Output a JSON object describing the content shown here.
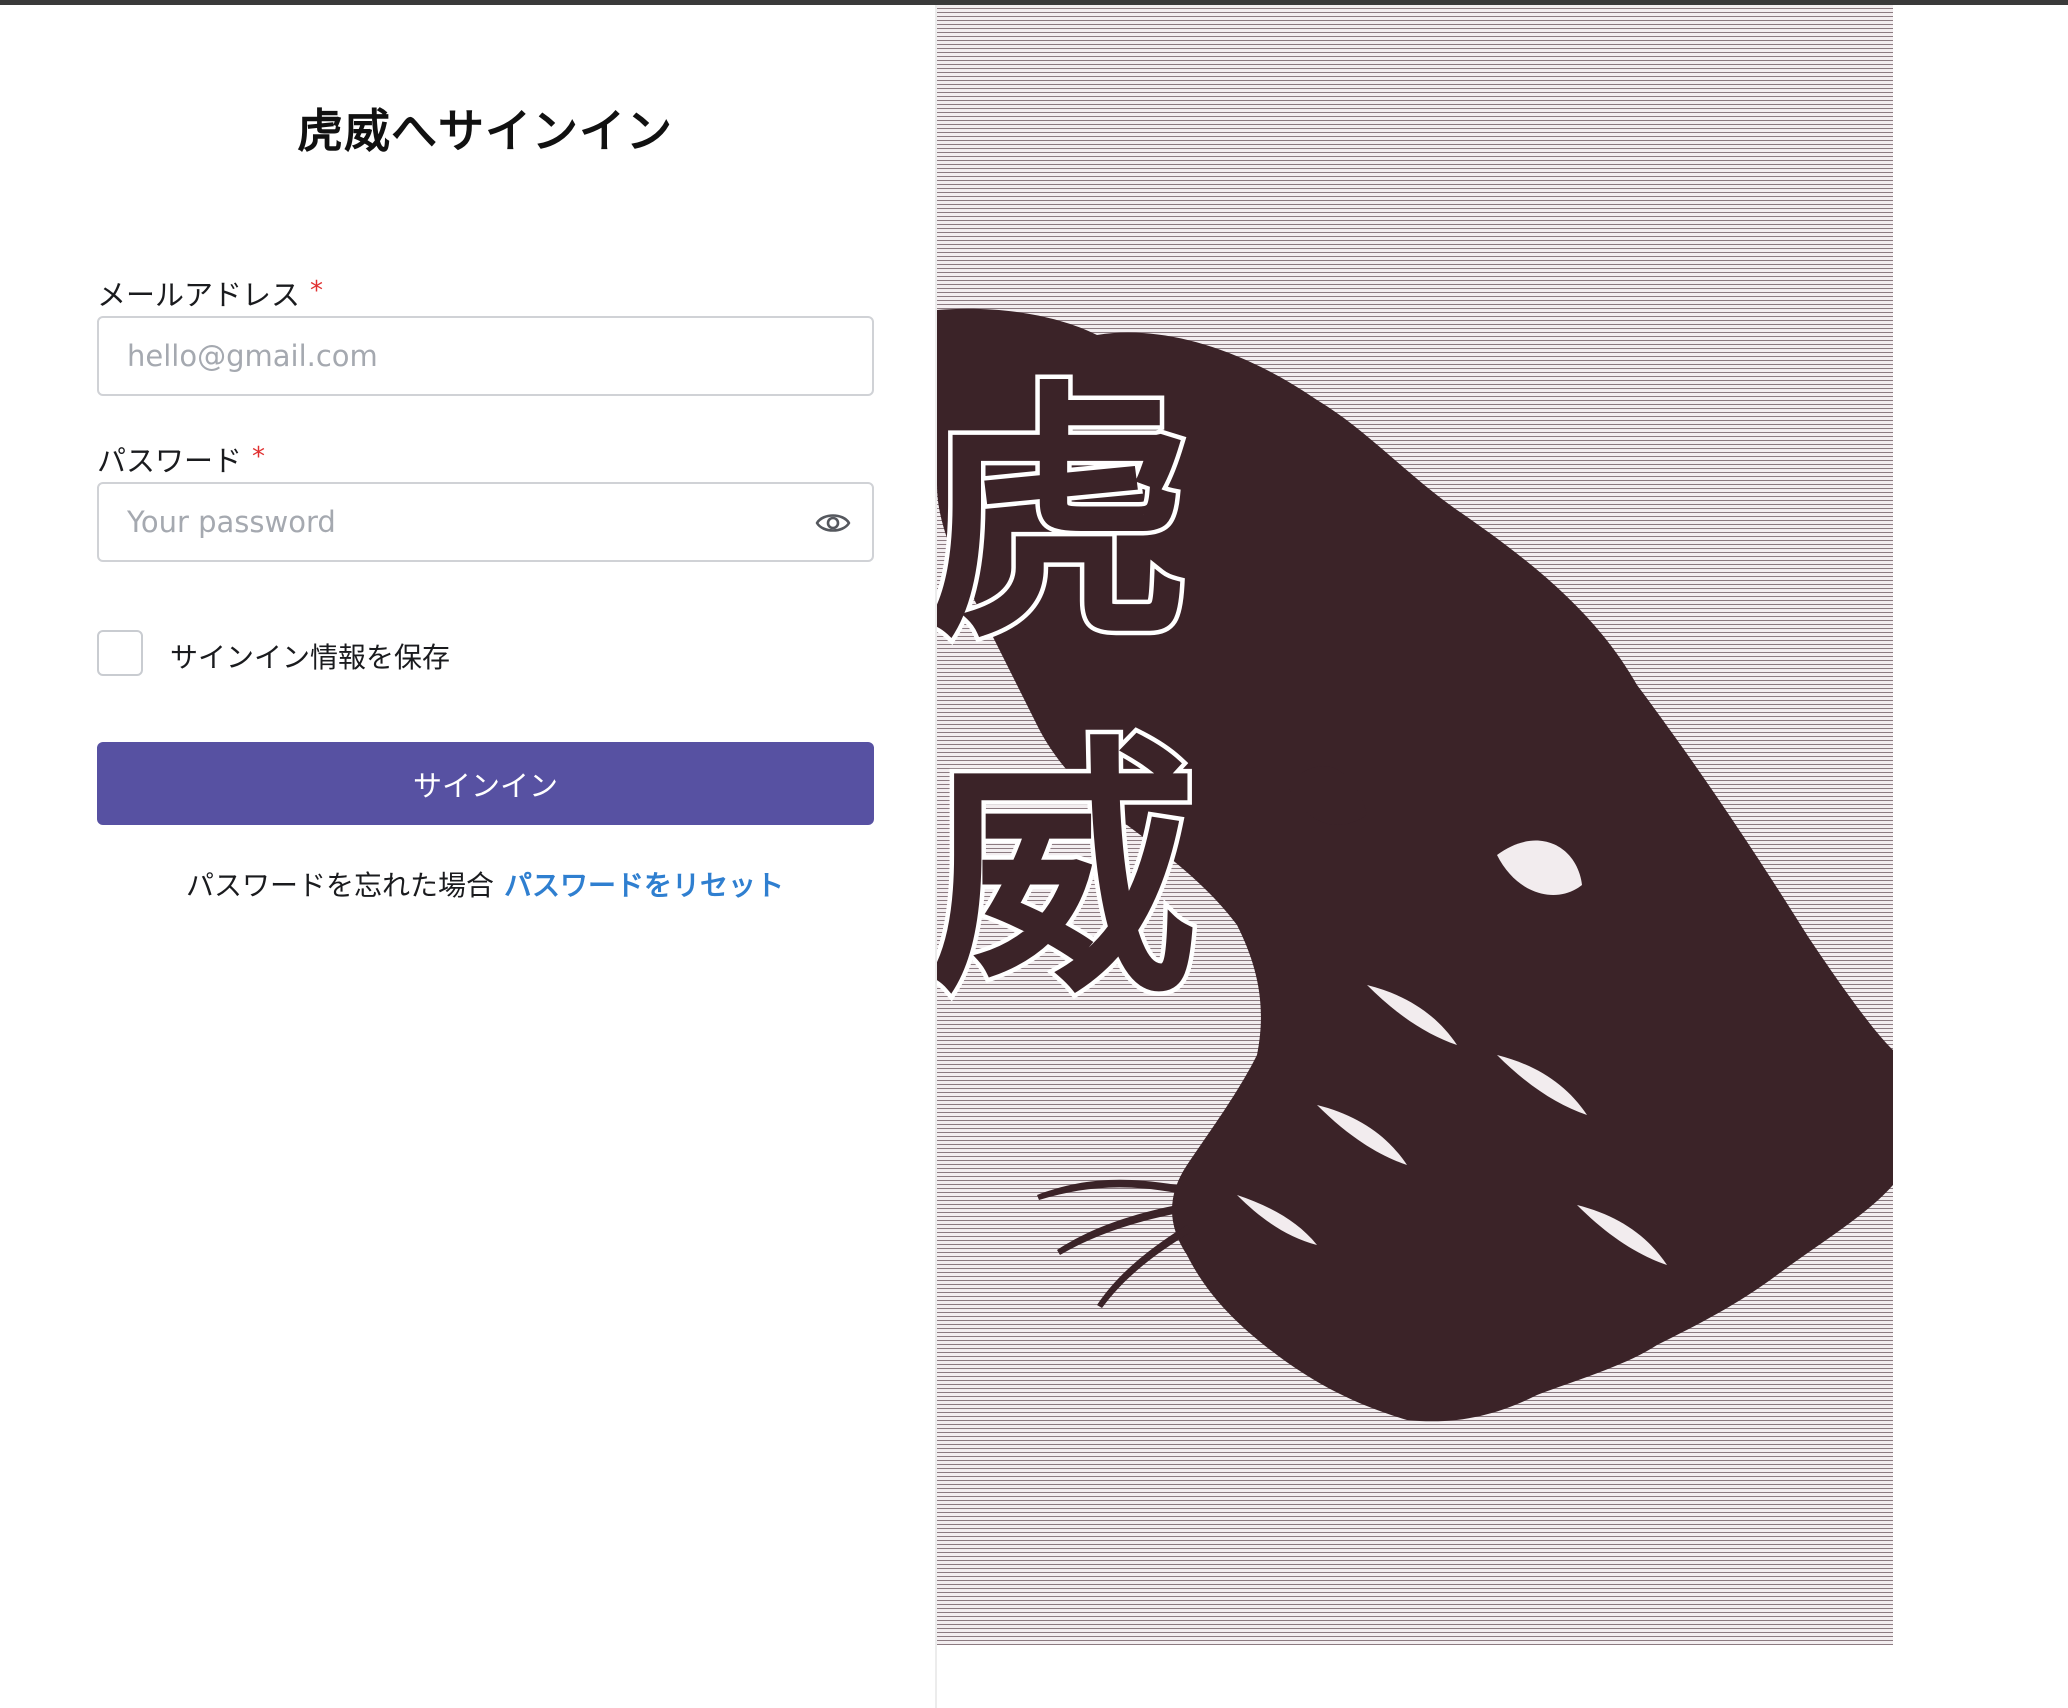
{
  "page": {
    "title": "虎威へサインイン"
  },
  "form": {
    "email_label": "メールアドレス",
    "email_required_mark": "*",
    "email_placeholder": "hello@gmail.com",
    "email_value": "",
    "password_label": "パスワード",
    "password_required_mark": "*",
    "password_placeholder": "Your password",
    "password_value": "",
    "password_toggle_icon": "eye-icon",
    "remember_label": "サインイン情報を保存",
    "remember_checked": false,
    "submit_label": "サインイン",
    "forgot_text": "パスワードを忘れた場合",
    "reset_link": "パスワードをリセット"
  },
  "artwork": {
    "calligraphy_chars": [
      "虎",
      "威"
    ],
    "accent_color": "#3b2328"
  },
  "colors": {
    "primary_button": "#5751a2",
    "link": "#2f7fd0",
    "required": "#e03131"
  }
}
